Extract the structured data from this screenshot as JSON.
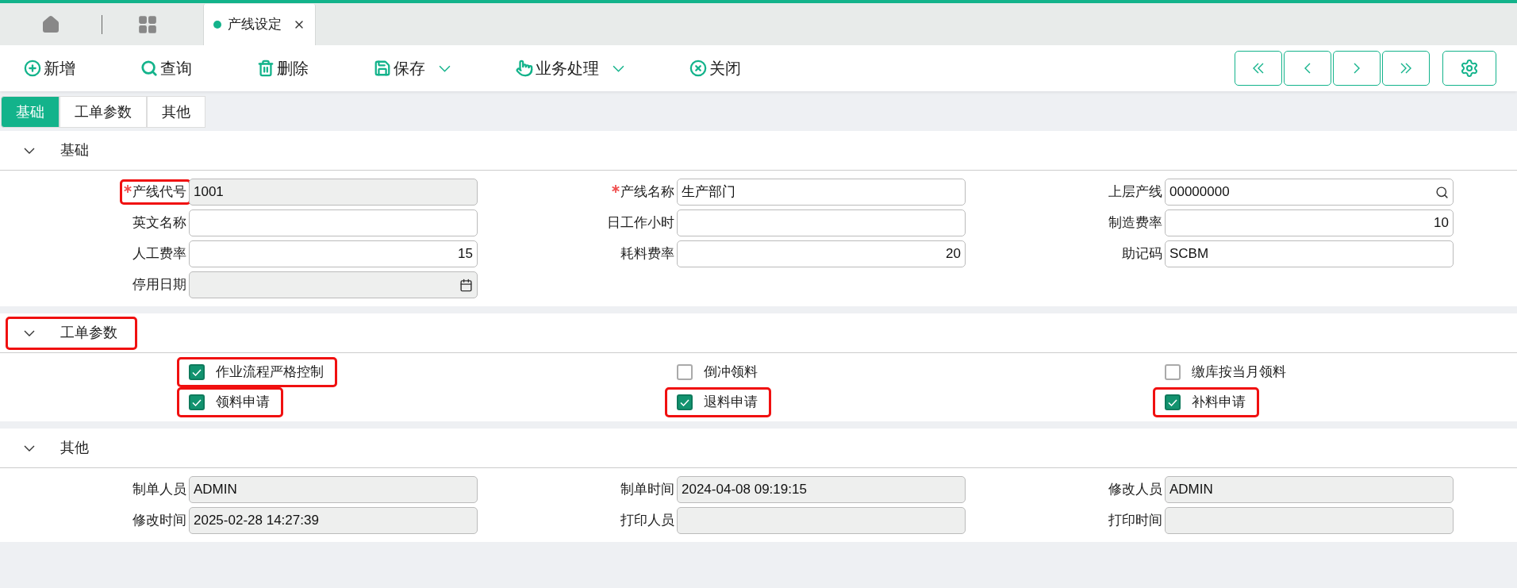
{
  "tabs": [
    {
      "label": "产线设定",
      "selected": true
    }
  ],
  "toolbar": [
    {
      "label": "新增",
      "dropdown": false
    },
    {
      "label": "查询",
      "dropdown": false
    },
    {
      "label": "删除",
      "dropdown": false
    },
    {
      "label": "保存",
      "dropdown": true
    },
    {
      "label": "业务处理",
      "dropdown": true
    },
    {
      "label": "关闭",
      "dropdown": false
    }
  ],
  "page_tabs": [
    {
      "label": "基础",
      "selected": true
    },
    {
      "label": "工单参数",
      "selected": false
    },
    {
      "label": "其他",
      "selected": false
    }
  ],
  "sections": [
    {
      "title": "基础",
      "expanded": true,
      "highlighted": false,
      "kind": "fields",
      "fields": [
        {
          "label": "产线代号",
          "value": "1001",
          "kind": "text",
          "required": true,
          "readonly": true,
          "highlighted": true
        },
        {
          "label": "产线名称",
          "value": "生产部门",
          "kind": "text",
          "required": true,
          "readonly": false,
          "highlighted": false
        },
        {
          "label": "上层产线",
          "value": "00000000",
          "kind": "lookup",
          "required": false,
          "readonly": false,
          "highlighted": false
        },
        {
          "label": "英文名称",
          "kind": "text",
          "required": false,
          "readonly": false,
          "highlighted": false
        },
        {
          "label": "日工作小时",
          "kind": "number",
          "required": false,
          "readonly": false,
          "highlighted": false
        },
        {
          "label": "制造费率",
          "value": "10",
          "kind": "number",
          "required": false,
          "readonly": false,
          "highlighted": false
        },
        {
          "label": "人工费率",
          "value": "15",
          "kind": "number",
          "required": false,
          "readonly": false,
          "highlighted": false
        },
        {
          "label": "耗料费率",
          "value": "20",
          "kind": "number",
          "required": false,
          "readonly": false,
          "highlighted": false
        },
        {
          "label": "助记码",
          "value": "SCBM",
          "kind": "text",
          "required": false,
          "readonly": false,
          "highlighted": false
        },
        {
          "label": "停用日期",
          "kind": "date",
          "required": false,
          "readonly": true,
          "highlighted": false
        }
      ]
    },
    {
      "title": "工单参数",
      "expanded": true,
      "highlighted": true,
      "kind": "checks",
      "checks": [
        {
          "label": "作业流程严格控制",
          "checked": true,
          "highlighted": true
        },
        {
          "label": "倒冲领料",
          "checked": false,
          "highlighted": false
        },
        {
          "label": "缴库按当月领料",
          "checked": false,
          "highlighted": false
        },
        {
          "label": "领料申请",
          "checked": true,
          "highlighted": true
        },
        {
          "label": "退料申请",
          "checked": true,
          "highlighted": true
        },
        {
          "label": "补料申请",
          "checked": true,
          "highlighted": true
        }
      ]
    },
    {
      "title": "其他",
      "expanded": true,
      "highlighted": false,
      "kind": "fields",
      "fields": [
        {
          "label": "制单人员",
          "value": "ADMIN",
          "kind": "text",
          "required": false,
          "readonly": true,
          "highlighted": false
        },
        {
          "label": "制单时间",
          "value": "2024-04-08 09:19:15",
          "kind": "text",
          "required": false,
          "readonly": true,
          "highlighted": false
        },
        {
          "label": "修改人员",
          "value": "ADMIN",
          "kind": "text",
          "required": false,
          "readonly": true,
          "highlighted": false
        },
        {
          "label": "修改时间",
          "value": "2025-02-28 14:27:39",
          "kind": "text",
          "required": false,
          "readonly": true,
          "highlighted": false
        },
        {
          "label": "打印人员",
          "kind": "text",
          "required": false,
          "readonly": true,
          "highlighted": false
        },
        {
          "label": "打印时间",
          "kind": "text",
          "required": false,
          "readonly": true,
          "highlighted": false
        }
      ]
    }
  ]
}
